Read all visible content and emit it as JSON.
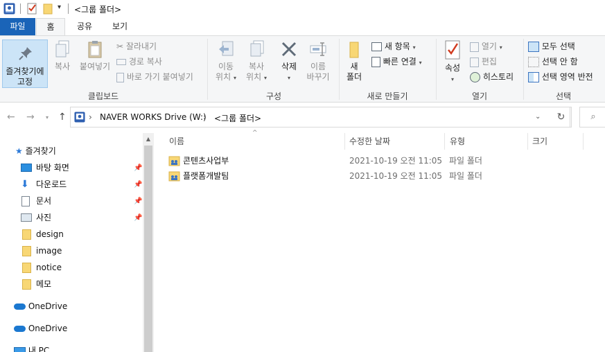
{
  "window": {
    "title": "<그룹 폴더>"
  },
  "tabs": [
    {
      "label": "파일"
    },
    {
      "label": "홈"
    },
    {
      "label": "공유"
    },
    {
      "label": "보기"
    }
  ],
  "ribbon": {
    "clipboard": {
      "pin_label_1": "즐겨찾기에",
      "pin_label_2": "고정",
      "copy": "복사",
      "paste": "붙여넣기",
      "cut": "잘라내기",
      "copy_path": "경로 복사",
      "paste_shortcut": "바로 가기 붙여넣기",
      "group": "클립보드"
    },
    "organize": {
      "move_1": "이동",
      "move_2": "위치",
      "copyto_1": "복사",
      "copyto_2": "위치",
      "delete": "삭제",
      "rename_1": "이름",
      "rename_2": "바꾸기",
      "group": "구성"
    },
    "new": {
      "folder_1": "새",
      "folder_2": "폴더",
      "new_item": "새 항목",
      "easy_access": "빠른 연결",
      "group": "새로 만들기"
    },
    "open": {
      "properties": "속성",
      "open": "열기",
      "edit": "편집",
      "history": "히스토리",
      "group": "열기"
    },
    "select": {
      "select_all": "모두 선택",
      "select_none": "선택 안 함",
      "invert": "선택 영역 반전",
      "group": "선택"
    }
  },
  "address": {
    "segments": [
      "NAVER WORKS Drive (W:)",
      "<그룹 폴더>"
    ]
  },
  "nav": {
    "quick_access": "즐겨찾기",
    "items": [
      {
        "label": "바탕 화면",
        "pinned": true
      },
      {
        "label": "다운로드",
        "pinned": true
      },
      {
        "label": "문서",
        "pinned": true
      },
      {
        "label": "사진",
        "pinned": true
      },
      {
        "label": "design",
        "pinned": false
      },
      {
        "label": "image",
        "pinned": false
      },
      {
        "label": "notice",
        "pinned": false
      },
      {
        "label": "메모",
        "pinned": false
      }
    ],
    "onedrive_1": "OneDrive",
    "onedrive_2": "OneDrive",
    "this_pc": "내 PC"
  },
  "columns": {
    "name": "이름",
    "date": "수정한 날짜",
    "type": "유형",
    "size": "크기"
  },
  "files": [
    {
      "name": "콘텐츠사업부",
      "date": "2021-10-19 오전 11:05",
      "type": "파일 폴더"
    },
    {
      "name": "플랫폼개발팀",
      "date": "2021-10-19 오전 11:05",
      "type": "파일 폴더"
    }
  ],
  "colors": {
    "accent": "#1a64b8",
    "folder": "#f8d775",
    "selected": "#cce4f7"
  }
}
